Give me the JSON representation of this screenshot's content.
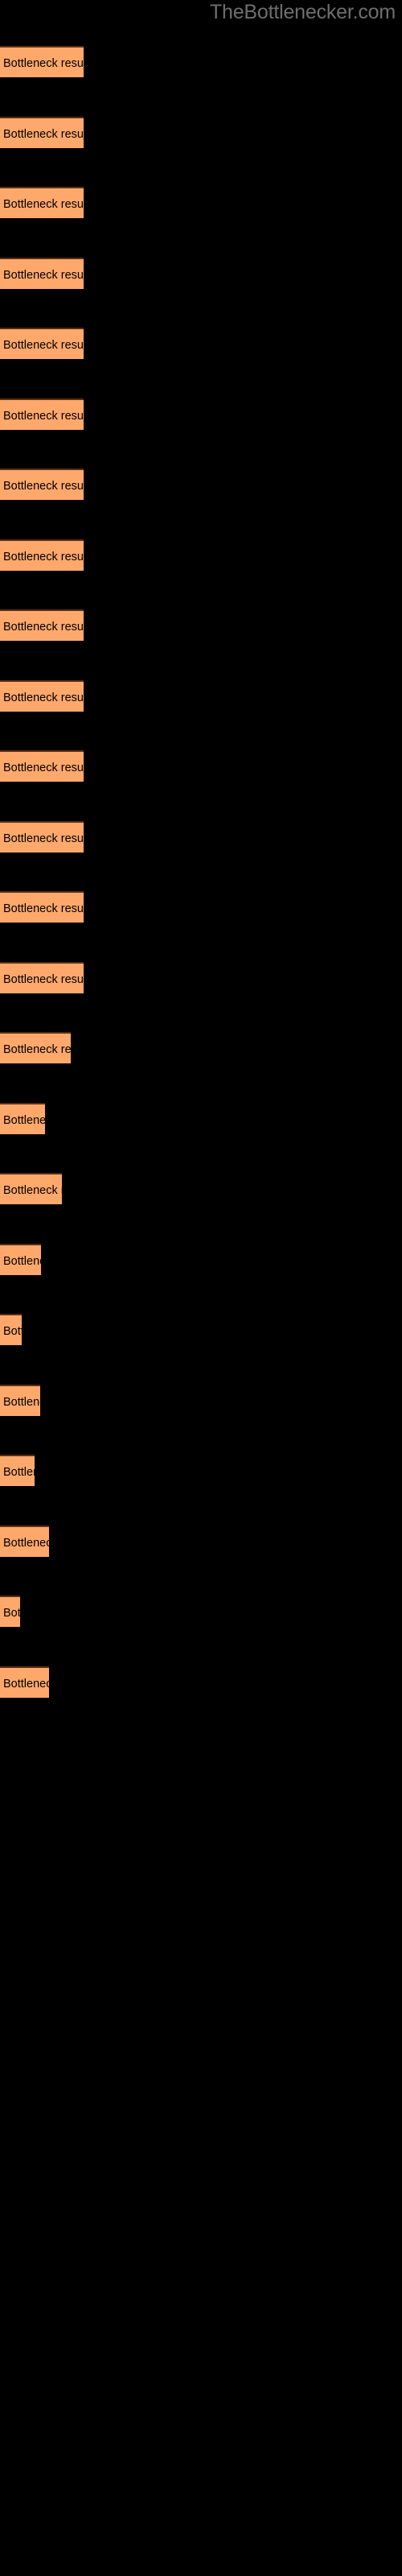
{
  "header": {
    "site_title": "TheBottlenecker.com",
    "title_color": "#6e6e6e"
  },
  "colors": {
    "background": "#000000",
    "bar_fill": "#ffa86b",
    "bar_border_top": "#5a2d10",
    "bar_label_text": "#000000"
  },
  "chart_data": {
    "type": "bar",
    "orientation": "horizontal",
    "title": "TheBottlenecker.com",
    "xlabel": "",
    "ylabel": "",
    "grid": false,
    "legend": null,
    "axis_visible": false,
    "bar_label_text": "Bottleneck result",
    "categories": [
      "Bottleneck result",
      "Bottleneck result",
      "Bottleneck result",
      "Bottleneck result",
      "Bottleneck result",
      "Bottleneck result",
      "Bottleneck result",
      "Bottleneck result",
      "Bottleneck result",
      "Bottleneck result",
      "Bottleneck result",
      "Bottleneck result",
      "Bottleneck result",
      "Bottleneck result",
      "Bottleneck result",
      "Bottleneck result",
      "Bottleneck result",
      "Bottleneck result",
      "Bottleneck result",
      "Bottleneck result",
      "Bottleneck result",
      "Bottleneck result",
      "Bottleneck result",
      "Bottleneck result"
    ],
    "values": [
      104,
      104,
      104,
      104,
      104,
      104,
      104,
      104,
      104,
      104,
      104,
      104,
      104,
      104,
      88,
      56,
      77,
      51,
      27,
      50,
      43,
      61,
      25,
      61
    ],
    "xlim": [
      0,
      500
    ],
    "bars": [
      {
        "index": 1,
        "label": "Bottleneck result",
        "width": 104,
        "top": 57,
        "visible_text": "Bottleneck result"
      },
      {
        "index": 2,
        "label": "Bottleneck result",
        "width": 104,
        "top": 145,
        "visible_text": "Bottleneck result"
      },
      {
        "index": 3,
        "label": "Bottleneck result",
        "width": 104,
        "top": 232,
        "visible_text": "Bottleneck result"
      },
      {
        "index": 4,
        "label": "Bottleneck result",
        "width": 104,
        "top": 320,
        "visible_text": "Bottleneck result"
      },
      {
        "index": 5,
        "label": "Bottleneck result",
        "width": 104,
        "top": 407,
        "visible_text": "Bottleneck result"
      },
      {
        "index": 6,
        "label": "Bottleneck result",
        "width": 104,
        "top": 495,
        "visible_text": "Bottleneck result"
      },
      {
        "index": 7,
        "label": "Bottleneck result",
        "width": 104,
        "top": 582,
        "visible_text": "Bottleneck result"
      },
      {
        "index": 8,
        "label": "Bottleneck result",
        "width": 104,
        "top": 670,
        "visible_text": "Bottleneck result"
      },
      {
        "index": 9,
        "label": "Bottleneck result",
        "width": 104,
        "top": 757,
        "visible_text": "Bottleneck result"
      },
      {
        "index": 10,
        "label": "Bottleneck result",
        "width": 104,
        "top": 845,
        "visible_text": "Bottleneck result"
      },
      {
        "index": 11,
        "label": "Bottleneck result",
        "width": 104,
        "top": 932,
        "visible_text": "Bottleneck result"
      },
      {
        "index": 12,
        "label": "Bottleneck result",
        "width": 104,
        "top": 1020,
        "visible_text": "Bottleneck result"
      },
      {
        "index": 13,
        "label": "Bottleneck result",
        "width": 104,
        "top": 1107,
        "visible_text": "Bottleneck result"
      },
      {
        "index": 14,
        "label": "Bottleneck result",
        "width": 104,
        "top": 1195,
        "visible_text": "Bottleneck result"
      },
      {
        "index": 15,
        "label": "Bottleneck result",
        "width": 88,
        "top": 1282,
        "visible_text": "Bottleneck re"
      },
      {
        "index": 16,
        "label": "Bottleneck result",
        "width": 56,
        "top": 1370,
        "visible_text": "Bottlene"
      },
      {
        "index": 17,
        "label": "Bottleneck result",
        "width": 77,
        "top": 1457,
        "visible_text": "Bottleneck r"
      },
      {
        "index": 18,
        "label": "Bottleneck result",
        "width": 51,
        "top": 1545,
        "visible_text": "Bottlen"
      },
      {
        "index": 19,
        "label": "Bottleneck result",
        "width": 27,
        "top": 1632,
        "visible_text": "Bot"
      },
      {
        "index": 20,
        "label": "Bottleneck result",
        "width": 50,
        "top": 1720,
        "visible_text": "Bottlen"
      },
      {
        "index": 21,
        "label": "Bottleneck result",
        "width": 43,
        "top": 1807,
        "visible_text": "Bottle"
      },
      {
        "index": 22,
        "label": "Bottleneck result",
        "width": 61,
        "top": 1895,
        "visible_text": "Bottlenec"
      },
      {
        "index": 23,
        "label": "Bottleneck result",
        "width": 25,
        "top": 1982,
        "visible_text": "Bo"
      },
      {
        "index": 24,
        "label": "Bottleneck result",
        "width": 61,
        "top": 2070,
        "visible_text": "Bottler"
      }
    ]
  }
}
